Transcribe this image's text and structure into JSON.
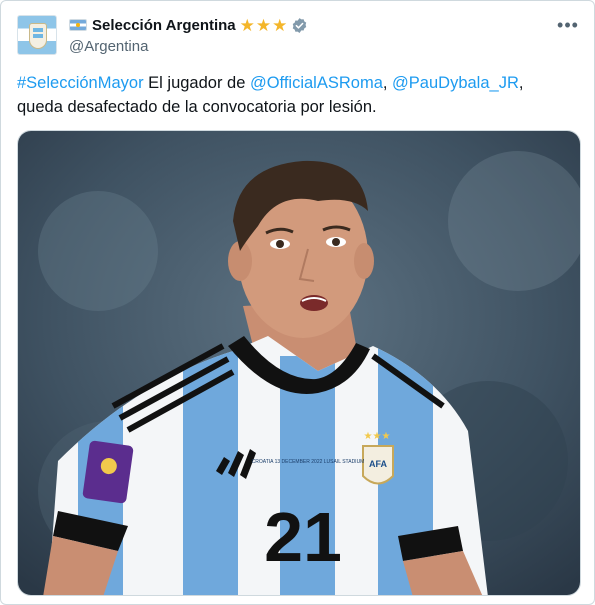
{
  "author": {
    "display_name": "Selección Argentina",
    "handle": "@Argentina"
  },
  "tweet": {
    "hashtag": "#SelecciónMayor",
    "text_1": " El jugador de ",
    "mention_1": "@OfficialASRoma",
    "text_2": ", ",
    "mention_2": "@PauDybala_JR",
    "text_3": ",",
    "text_4": "queda desafectado de la convocatoria por lesión."
  },
  "jersey": {
    "number": "21",
    "tag": "AFA",
    "match_info": "CROATIA 13 DECEMBER 2022 LUSAIL STADIUM"
  },
  "colors": {
    "link": "#1d9bf0",
    "star": "#f4b62a",
    "verified": "#829aab",
    "jersey_blue": "#6fa8dc"
  },
  "icons": {
    "flag": "argentina-flag-icon",
    "star": "gold-star-icon",
    "verified": "verified-badge-icon",
    "more": "more-options-icon"
  }
}
